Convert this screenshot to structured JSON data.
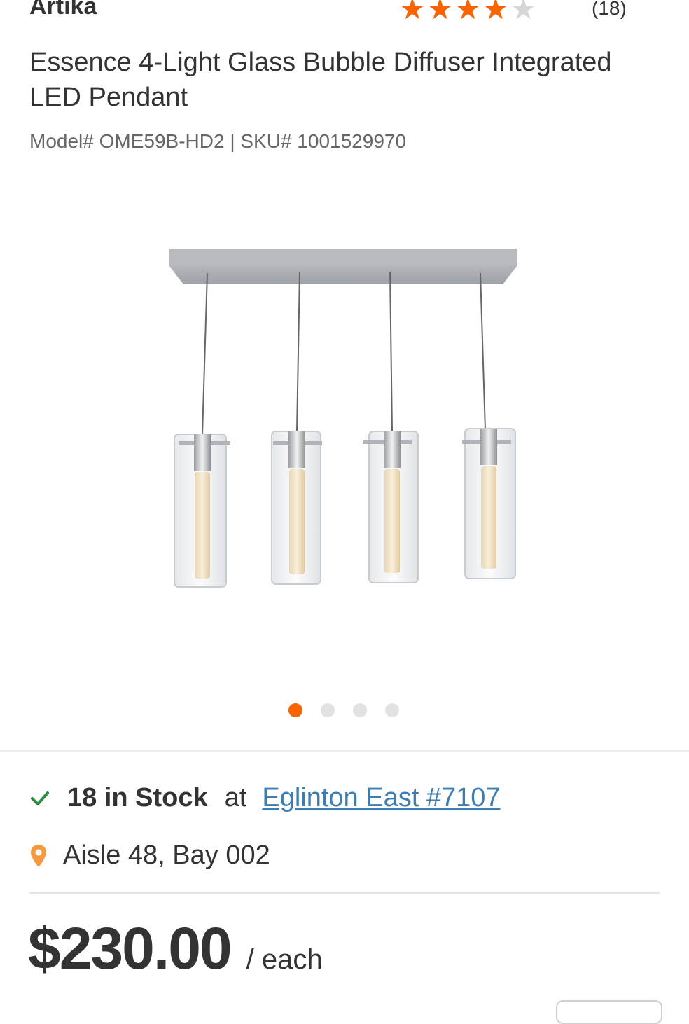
{
  "header": {
    "brand": "Artika",
    "rating": {
      "value": 4,
      "max": 5
    },
    "review_count": "(18)"
  },
  "product": {
    "title": "Essence 4-Light Glass Bubble Diffuser Integrated LED Pendant",
    "model_sku": "Model# OME59B-HD2 | SKU# 1001529970"
  },
  "image": {
    "icon": "pendant-light-product-image",
    "carousel": {
      "count": 4,
      "active": 1
    }
  },
  "availability": {
    "stock_text": "18 in Stock",
    "at_text": "at",
    "store_link": "Eglinton East #7107",
    "aisle_text": "Aisle 48, Bay 002"
  },
  "pricing": {
    "price": "$230.00",
    "unit": "/ each"
  },
  "colors": {
    "accent": "#f96302",
    "link": "#3e7db3",
    "check": "#2b8a3e"
  }
}
